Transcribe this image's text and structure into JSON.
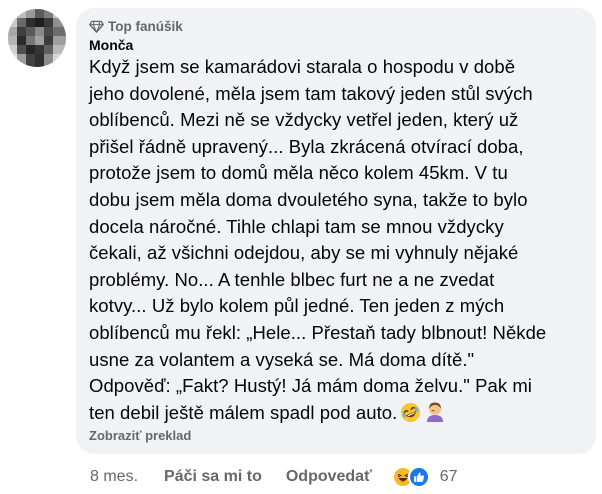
{
  "comment": {
    "badge_icon": "diamond-icon",
    "badge_label": "Top fanúšik",
    "author": "Monča",
    "text": "Když jsem se kamarádovi starala o hospodu v době\njeho dovolené, měla jsem tam takový jeden stůl svých\noblíbenců. Mezi ně se vždycky vetřel jeden, který už\npřišel řádně upravený... Byla zkrácená otvírací doba,\nprotože jsem to domů měla něco kolem 45km. V tu\ndobu jsem měla doma dvouletého syna, takže to bylo\ndocela náročné. Tihle chlapi tam se mnou vždycky\nčekali, až všichni odejdou, aby se mi vyhnuly nějaké\nproblémy. No... A tenhle blbec furt ne a ne zvedat\nkotvy... Už bylo kolem půl jedné. Ten jeden z mých\noblíbenců mu řekl: „Hele... Přestaň tady blbnout! Někde\nusne za volantem a vyseká se. Má doma dítě.\"\nOdpověď: „Fakt? Hustý! Já mám doma želvu.\" Pak mi\nten debil ještě málem spadl pod auto.",
    "emojis": [
      "rolling-on-floor-laughing-emoji",
      "woman-facepalming-emoji"
    ],
    "translate_label": "Zobraziť preklad"
  },
  "actions": {
    "time": "8 mes.",
    "like_label": "Páči sa mi to",
    "reply_label": "Odpovedať",
    "reactions": [
      "haha-reaction",
      "like-reaction"
    ],
    "reaction_count": "67"
  },
  "colors": {
    "bubble": "#f0f2f5",
    "text": "#050505",
    "secondary": "#65676b",
    "like_blue": "#1877f2",
    "haha_yellow": "#f7b928"
  }
}
